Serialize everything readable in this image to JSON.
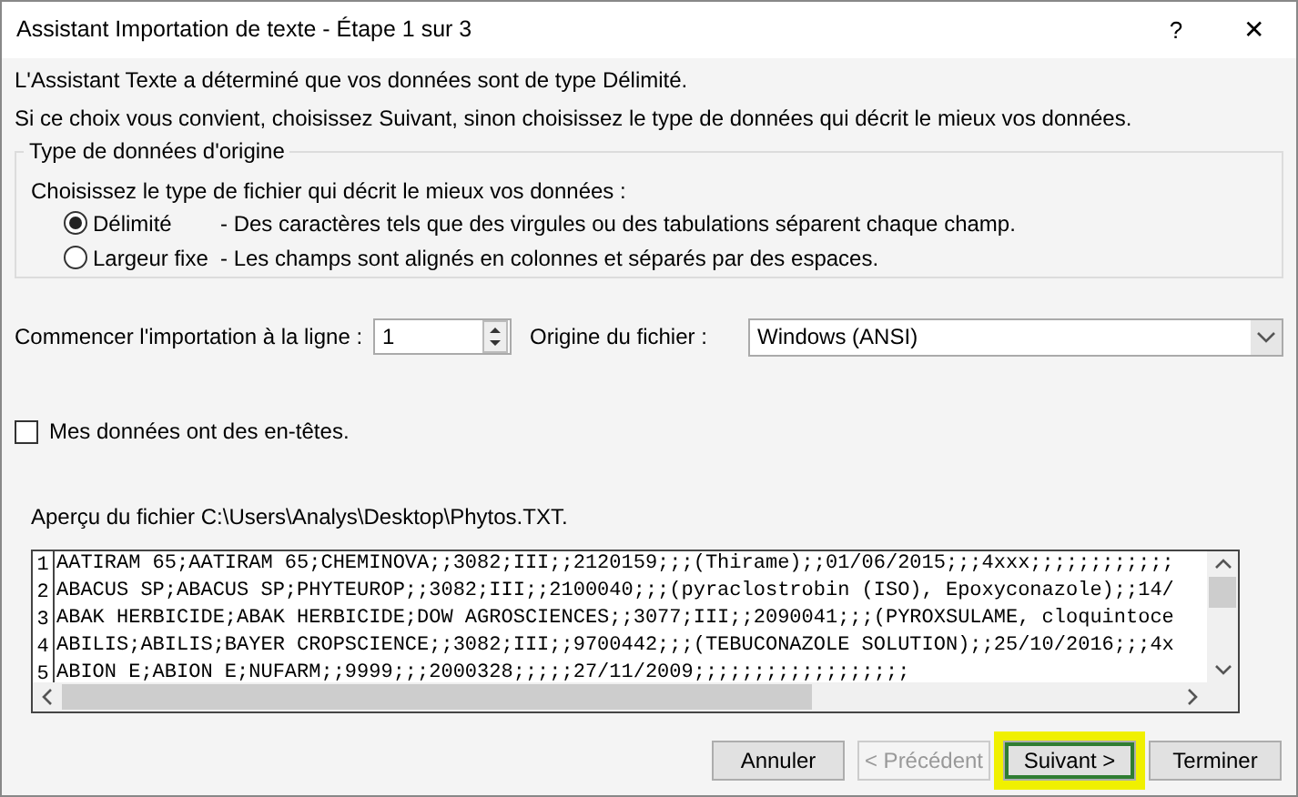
{
  "window": {
    "title": "Assistant Importation de texte - Étape 1 sur 3",
    "help": "?",
    "close": "✕"
  },
  "intro": [
    "L'Assistant Texte a déterminé que vos données sont de type Délimité.",
    "Si ce choix vous convient, choisissez Suivant, sinon choisissez le type de données qui décrit le mieux vos données."
  ],
  "group": {
    "title": "Type de données d'origine",
    "prompt": "Choisissez le type de fichier qui décrit le mieux vos données :",
    "options": [
      {
        "label": "Délimité",
        "description": "- Des caractères tels que des virgules ou des tabulations séparent chaque champ.",
        "selected": true
      },
      {
        "label": "Largeur fixe",
        "description": "- Les champs sont alignés en colonnes et séparés par des espaces.",
        "selected": false
      }
    ]
  },
  "start_row": {
    "label": "Commencer l'importation à la ligne :",
    "value": "1"
  },
  "file_origin": {
    "label": "Origine du fichier :",
    "value": "Windows (ANSI)"
  },
  "headers_checkbox": {
    "label": "Mes données ont des en-têtes.",
    "checked": false
  },
  "preview": {
    "title": "Aperçu du fichier C:\\Users\\Analys\\Desktop\\Phytos.TXT.",
    "lines": [
      {
        "number": "1",
        "text": "AATIRAM 65;AATIRAM 65;CHEMINOVA;;3082;III;;2120159;;;(Thirame);;01/06/2015;;;4xxx;;;;;;;;;;;;"
      },
      {
        "number": "2",
        "text": "ABACUS SP;ABACUS SP;PHYTEUROP;;3082;III;;2100040;;;(pyraclostrobin (ISO), Epoxyconazole);;14/"
      },
      {
        "number": "3",
        "text": "ABAK HERBICIDE;ABAK HERBICIDE;DOW AGROSCIENCES;;3077;III;;2090041;;;(PYROXSULAME, cloquintoce"
      },
      {
        "number": "4",
        "text": "ABILIS;ABILIS;BAYER CROPSCIENCE;;3082;III;;9700442;;;(TEBUCONAZOLE SOLUTION);;25/10/2016;;;4x"
      },
      {
        "number": "5",
        "text": "ABION E;ABION E;NUFARM;;9999;;;2000328;;;;;27/11/2009;;;;;;;;;;;;;;;;;;"
      }
    ]
  },
  "buttons": [
    {
      "label": "Annuler",
      "disabled": false,
      "highlighted": false
    },
    {
      "label": "< Précédent",
      "disabled": true,
      "highlighted": false
    },
    {
      "label": "Suivant >",
      "disabled": false,
      "highlighted": true
    },
    {
      "label": "Terminer",
      "disabled": false,
      "highlighted": false
    }
  ]
}
